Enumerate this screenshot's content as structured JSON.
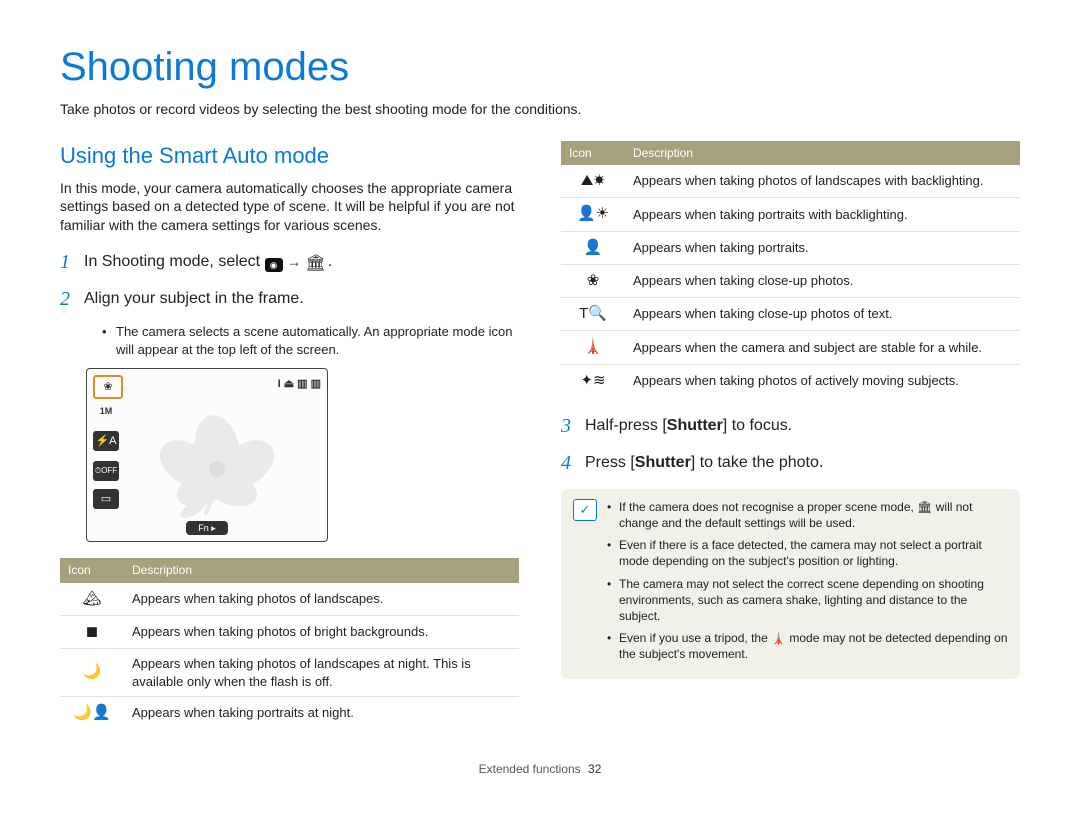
{
  "title": "Shooting modes",
  "subtitle": "Take photos or record videos by selecting the best shooting mode for the conditions.",
  "section": "Using the Smart Auto mode",
  "intro": "In this mode, your camera automatically chooses the appropriate camera settings based on a detected type of scene. It will be helpful if you are not familiar with the camera settings for various scenes.",
  "steps": {
    "s1": {
      "num": "1",
      "text": "In Shooting mode, select",
      "tail": "."
    },
    "s2": {
      "num": "2",
      "text": "Align your subject in the frame."
    },
    "s2_bullet": "The camera selects a scene automatically. An appropriate mode icon will appear at the top left of the screen.",
    "s3": {
      "num": "3",
      "pre": "Half-press [",
      "bold": "Shutter",
      "post": "] to focus."
    },
    "s4": {
      "num": "4",
      "pre": "Press [",
      "bold": "Shutter",
      "post": "] to take the photo."
    }
  },
  "tableHeaders": {
    "icon": "Icon",
    "desc": "Description"
  },
  "table1": [
    {
      "icon": "🏔",
      "desc": "Appears when taking photos of landscapes."
    },
    {
      "icon": "◼",
      "desc": "Appears when taking photos of bright backgrounds."
    },
    {
      "icon": "🌙",
      "desc": "Appears when taking photos of landscapes at night. This is available only when the flash is off."
    },
    {
      "icon": "🌙👤",
      "desc": "Appears when taking portraits at night."
    }
  ],
  "table2": [
    {
      "icon": "⛰☀",
      "desc": "Appears when taking photos of landscapes with backlighting."
    },
    {
      "icon": "👤☀",
      "desc": "Appears when taking portraits with backlighting."
    },
    {
      "icon": "👤",
      "desc": "Appears when taking portraits."
    },
    {
      "icon": "❀",
      "desc": "Appears when taking close-up photos."
    },
    {
      "icon": "T🔍",
      "desc": "Appears when taking close-up photos of text."
    },
    {
      "icon": "🗼",
      "desc": "Appears when the camera and subject are stable for a while."
    },
    {
      "icon": "✦≋",
      "desc": "Appears when taking photos of actively moving subjects."
    }
  ],
  "notes": [
    "If the camera does not recognise a proper scene mode, 🏛 will not change and the default settings will be used.",
    "Even if there is a face detected, the camera may not select a portrait mode depending on the subject's position or lighting.",
    "The camera may not select the correct scene depending on shooting environments, such as camera shake, lighting and distance to the subject.",
    "Even if you use a tripod, the 🗼 mode may not be detected depending on the subject's movement."
  ],
  "preview": {
    "fn": "Fn ▸"
  },
  "footer": {
    "section": "Extended functions",
    "page": "32"
  }
}
